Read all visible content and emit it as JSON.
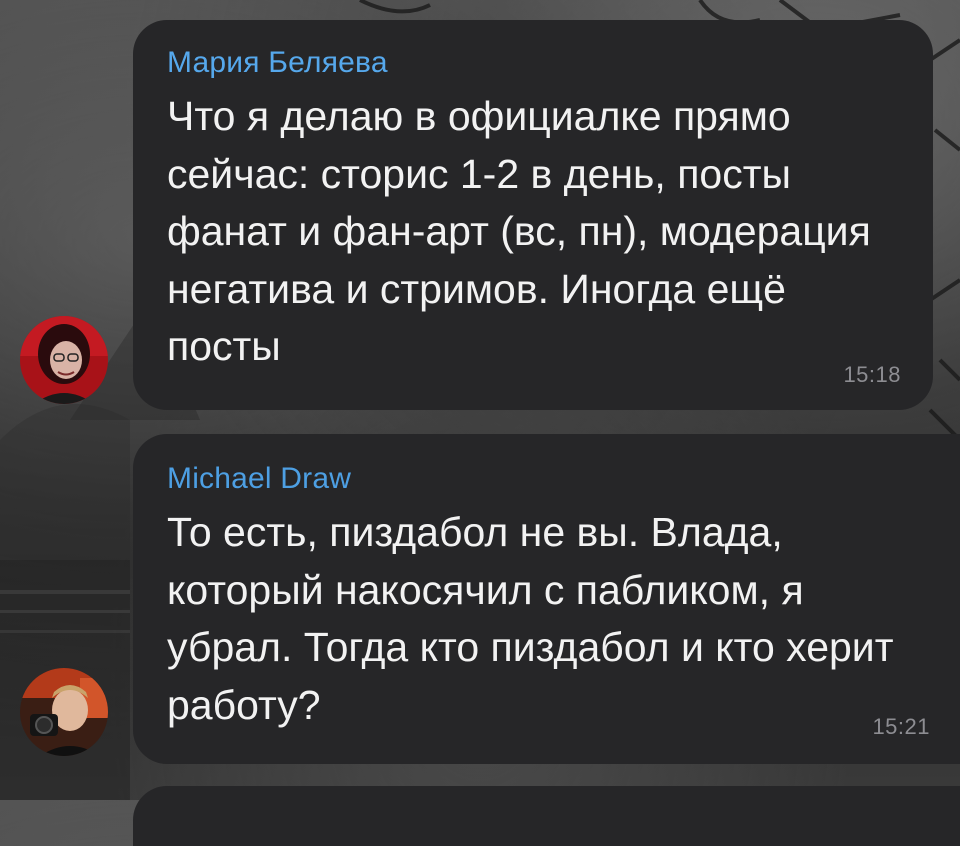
{
  "messages": [
    {
      "sender": "Мария Беляева",
      "text": "Что я делаю в официалке прямо сейчас: сторис 1-2 в день, посты фанат и фан-арт (вс, пн), модерация негатива и стримов. Иногда ещё посты",
      "time": "15:18"
    },
    {
      "sender": "Michael Draw",
      "text": "То есть, пиздабол не вы. Влада, который накосячил с пабликом, я убрал. Тогда кто пиздабол и кто херит работу?",
      "time": "15:21"
    }
  ],
  "colors": {
    "bubble": "#262628",
    "sender_name": "#56a8ec",
    "message_text": "#f2f2f2",
    "timestamp": "#8d8d92"
  }
}
